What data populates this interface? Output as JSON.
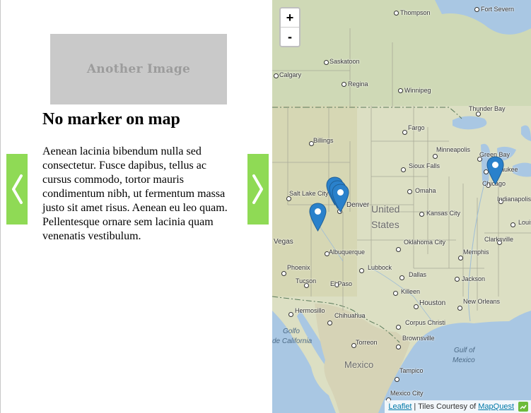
{
  "panel": {
    "image_placeholder_text": "Another Image",
    "title": "No marker on map",
    "body": "Aenean lacinia bibendum nulla sed consectetur. Fusce dapibus, tellus ac cursus commodo, tortor mauris condimentum nibh, ut fermentum massa justo sit amet risus. Aenean eu leo quam. Pellentesque ornare sem lacinia quam venenatis vestibulum."
  },
  "nav": {
    "prev_icon": "chevron-left-icon",
    "next_icon": "chevron-right-icon",
    "button_color": "#8fda55"
  },
  "map": {
    "zoom_in_label": "+",
    "zoom_out_label": "-",
    "cities": [
      "Thompson",
      "Fort Severn",
      "Saskatoon",
      "Regina",
      "Winnipeg",
      "Calgary",
      "Thunder Bay",
      "Billings",
      "Fargo",
      "Minneapolis",
      "Green Bay",
      "Milwaukee",
      "Sioux Falls",
      "Chicago",
      "Salt Lake City",
      "Omaha",
      "Indianapolis",
      "Denver",
      "Kansas City",
      "Louisville",
      "Clarksville",
      "Albuquerque",
      "Oklahoma City",
      "Memphis",
      "Phoenix",
      "Lubbock",
      "Dallas",
      "Tucson",
      "El Paso",
      "Killeen",
      "Jackson",
      "Houston",
      "Hermosillo",
      "New Orleans",
      "Chihuahua",
      "Corpus Christi",
      "Torreon",
      "Brownsville",
      "Tampico",
      "Mexico City",
      "Vegas"
    ],
    "regions": [
      "United",
      "States",
      "Mexico"
    ],
    "seas": [
      "Golfo",
      "de California",
      "Gulf of",
      "Mexico"
    ],
    "land_color": "#dcdfc3",
    "water_color": "#a9c7e3",
    "marker_color": "#2a81cb"
  },
  "attribution": {
    "leaflet_link": "Leaflet",
    "separator_text": "| Tiles Courtesy of",
    "mapquest_link": "MapQuest"
  }
}
